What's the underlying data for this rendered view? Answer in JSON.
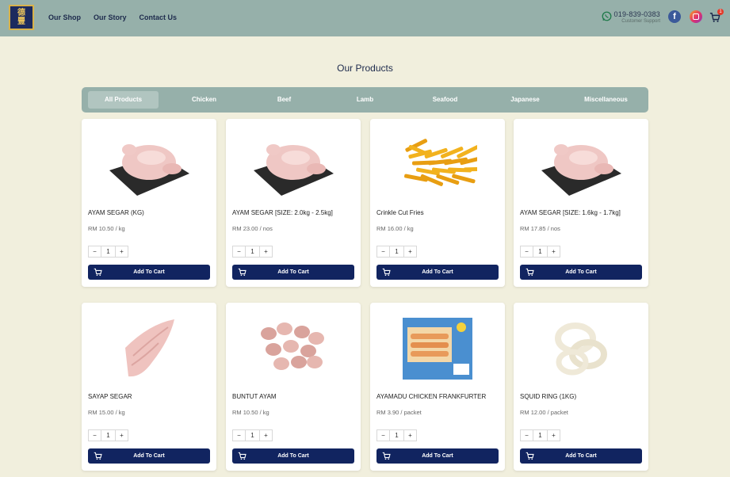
{
  "brand": {
    "logo_line1": "德",
    "logo_line2": "豐"
  },
  "nav": {
    "items": [
      "Our Shop",
      "Our Story",
      "Contact Us"
    ]
  },
  "support": {
    "phone": "019-839-0383",
    "label": "Customer Support"
  },
  "cart": {
    "count": "1"
  },
  "page": {
    "title": "Our Products"
  },
  "tabs": [
    "All Products",
    "Chicken",
    "Beef",
    "Lamb",
    "Seafood",
    "Japanese",
    "Miscellaneous"
  ],
  "active_tab": "All Products",
  "products": [
    {
      "name": "AYAM SEGAR (KG)",
      "price": "RM 10.50 / kg",
      "qty": "1",
      "button": "Add To Cart"
    },
    {
      "name": "AYAM SEGAR [SIZE: 2.0kg - 2.5kg]",
      "price": "RM 23.00 / nos",
      "qty": "1",
      "button": "Add To Cart"
    },
    {
      "name": "Crinkle Cut Fries",
      "price": "RM 16.00 / kg",
      "qty": "1",
      "button": "Add To Cart"
    },
    {
      "name": "AYAM SEGAR [SIZE: 1.6kg - 1.7kg]",
      "price": "RM 17.85 / nos",
      "qty": "1",
      "button": "Add To Cart"
    },
    {
      "name": "SAYAP SEGAR",
      "price": "RM 15.00 / kg",
      "qty": "1",
      "button": "Add To Cart"
    },
    {
      "name": "BUNTUT AYAM",
      "price": "RM 10.50 / kg",
      "qty": "1",
      "button": "Add To Cart"
    },
    {
      "name": "AYAMADU CHICKEN FRANKFURTER",
      "price": "RM 3.90 / packet",
      "qty": "1",
      "button": "Add To Cart"
    },
    {
      "name": "SQUID RING (1KG)",
      "price": "RM 12.00 / packet",
      "qty": "1",
      "button": "Add To Cart"
    }
  ],
  "qty_controls": {
    "minus": "−",
    "plus": "+"
  },
  "colors": {
    "header": "#96b0aa",
    "background": "#f1efdd",
    "button": "#112460"
  }
}
